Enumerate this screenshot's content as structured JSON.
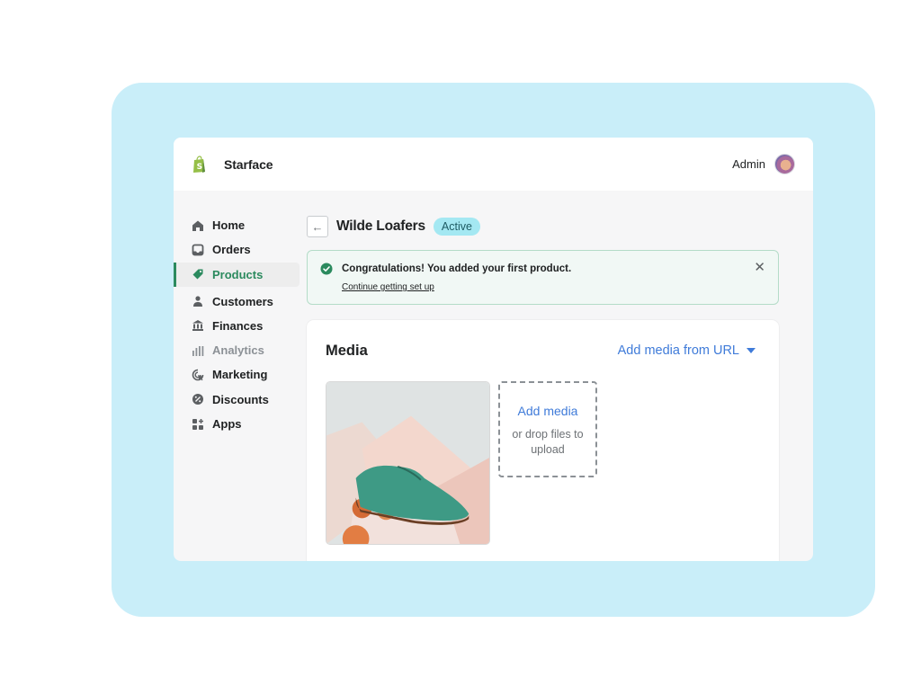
{
  "colors": {
    "backdrop": "#c9eef9",
    "accent_green": "#2b8a5e",
    "link_blue": "#3f7bd9",
    "badge_bg": "#a4e8f2",
    "banner_bg": "#f1f8f5"
  },
  "topbar": {
    "logo_icon": "shopify-bag-icon",
    "store_name": "Starface",
    "account_label": "Admin",
    "avatar_icon": "user-avatar"
  },
  "sidebar": {
    "items": [
      {
        "label": "Home",
        "icon": "home-icon",
        "state": "normal"
      },
      {
        "label": "Orders",
        "icon": "inbox-icon",
        "state": "normal"
      },
      {
        "label": "Products",
        "icon": "tag-icon",
        "state": "active"
      },
      {
        "label": "Customers",
        "icon": "person-icon",
        "state": "normal"
      },
      {
        "label": "Finances",
        "icon": "bank-icon",
        "state": "normal"
      },
      {
        "label": "Analytics",
        "icon": "bar-chart-icon",
        "state": "muted"
      },
      {
        "label": "Marketing",
        "icon": "target-cursor-icon",
        "state": "normal"
      },
      {
        "label": "Discounts",
        "icon": "discount-icon",
        "state": "normal"
      },
      {
        "label": "Apps",
        "icon": "apps-grid-icon",
        "state": "normal"
      }
    ]
  },
  "page": {
    "back_icon": "arrow-left-icon",
    "title": "Wilde Loafers",
    "status": "Active"
  },
  "banner": {
    "icon": "check-circle-icon",
    "title": "Congratulations! You added your first product.",
    "link": "Continue getting set up",
    "close_icon": "close-icon"
  },
  "media": {
    "title": "Media",
    "url_action": "Add media from URL",
    "product_image": "green suede loafer on peach blocks",
    "dropzone_title": "Add media",
    "dropzone_sub": "or drop files to upload"
  }
}
